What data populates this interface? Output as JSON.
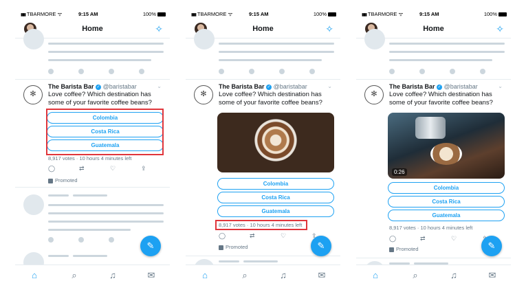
{
  "status": {
    "carrier": "TBARMORE",
    "time": "9:15 AM",
    "battery": "100%"
  },
  "header": {
    "title": "Home"
  },
  "tweet": {
    "name": "The Barista Bar",
    "handle": "@baristabar",
    "text": "Love coffee? Which destination has some of your favorite coffee beans?",
    "poll_options": [
      "Colombia",
      "Costa Rica",
      "Guatemala"
    ],
    "votes_text": "8,917 votes · 10 hours 4 minutes left",
    "promoted": "Promoted",
    "video_duration": "0:26"
  },
  "icons": {
    "reply": "reply-icon",
    "retweet": "retweet-icon",
    "like": "heart-icon",
    "share": "share-icon",
    "compose": "compose-tweet-icon",
    "sparkle": "sparkle-icon",
    "tabs": [
      "home-icon",
      "search-icon",
      "notifications-icon",
      "messages-icon"
    ]
  },
  "colors": {
    "accent": "#1da1f2",
    "highlight": "#e0353b",
    "muted": "#657786",
    "skeleton": "#ccd6dd"
  }
}
